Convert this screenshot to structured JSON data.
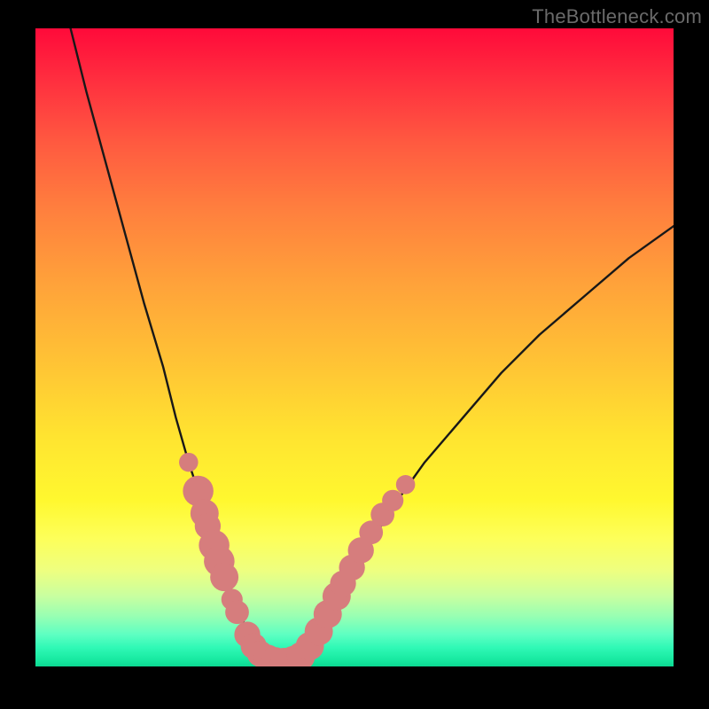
{
  "watermark": "TheBottleneck.com",
  "colors": {
    "curve_stroke": "#181818",
    "dot_fill": "#d67d7d",
    "gradient_top": "#ff0a3a",
    "gradient_bottom": "#0cd892",
    "frame_bg": "#000000"
  },
  "chart_data": {
    "type": "line",
    "title": "",
    "xlabel": "",
    "ylabel": "",
    "xlim": [
      0,
      100
    ],
    "ylim": [
      0,
      100
    ],
    "grid": false,
    "legend": false,
    "annotations": [
      "TheBottleneck.com"
    ],
    "note": "Axes are unlabeled. Values are estimated from pixel positions on a 0–100 normalized scale. Higher y = higher on screen (lower bottleneck).",
    "series": [
      {
        "name": "left-branch",
        "x": [
          5.5,
          8,
          11,
          14,
          17,
          20,
          22,
          24,
          26,
          28,
          30.5,
          33,
          35.5
        ],
        "y": [
          100,
          90,
          79,
          68,
          57,
          47,
          39,
          32,
          26,
          19,
          12,
          6,
          1
        ]
      },
      {
        "name": "valley-floor",
        "x": [
          35.5,
          37,
          38.5,
          40,
          41.5
        ],
        "y": [
          1,
          0.5,
          0.4,
          0.5,
          1
        ]
      },
      {
        "name": "right-branch",
        "x": [
          41.5,
          44,
          47,
          51,
          56,
          61,
          67,
          73,
          79,
          86,
          93,
          100
        ],
        "y": [
          1,
          5,
          10,
          17,
          25,
          32,
          39,
          46,
          52,
          58,
          64,
          69
        ]
      }
    ],
    "markers": {
      "name": "highlight-dots",
      "color": "#d67d7d",
      "points": [
        {
          "x": 24.0,
          "y": 32.0,
          "r": 1.2
        },
        {
          "x": 25.5,
          "y": 27.5,
          "r": 2.2
        },
        {
          "x": 26.5,
          "y": 24.0,
          "r": 2.0
        },
        {
          "x": 27.0,
          "y": 22.0,
          "r": 1.8
        },
        {
          "x": 28.0,
          "y": 19.0,
          "r": 2.2
        },
        {
          "x": 28.8,
          "y": 16.5,
          "r": 2.2
        },
        {
          "x": 29.6,
          "y": 14.0,
          "r": 2.0
        },
        {
          "x": 30.8,
          "y": 10.5,
          "r": 1.4
        },
        {
          "x": 31.6,
          "y": 8.5,
          "r": 1.6
        },
        {
          "x": 33.2,
          "y": 5.0,
          "r": 1.8
        },
        {
          "x": 34.2,
          "y": 3.2,
          "r": 1.8
        },
        {
          "x": 35.2,
          "y": 2.0,
          "r": 1.8
        },
        {
          "x": 36.4,
          "y": 1.2,
          "r": 2.0
        },
        {
          "x": 37.6,
          "y": 0.8,
          "r": 2.0
        },
        {
          "x": 39.0,
          "y": 0.7,
          "r": 2.0
        },
        {
          "x": 40.4,
          "y": 1.0,
          "r": 2.0
        },
        {
          "x": 41.6,
          "y": 1.6,
          "r": 2.0
        },
        {
          "x": 43.0,
          "y": 3.2,
          "r": 2.0
        },
        {
          "x": 44.4,
          "y": 5.5,
          "r": 2.0
        },
        {
          "x": 45.8,
          "y": 8.2,
          "r": 2.0
        },
        {
          "x": 47.2,
          "y": 11.0,
          "r": 2.0
        },
        {
          "x": 48.2,
          "y": 13.0,
          "r": 1.8
        },
        {
          "x": 49.6,
          "y": 15.5,
          "r": 1.8
        },
        {
          "x": 51.0,
          "y": 18.2,
          "r": 1.8
        },
        {
          "x": 52.6,
          "y": 21.0,
          "r": 1.6
        },
        {
          "x": 54.4,
          "y": 23.8,
          "r": 1.6
        },
        {
          "x": 56.0,
          "y": 26.0,
          "r": 1.4
        },
        {
          "x": 58.0,
          "y": 28.5,
          "r": 1.2
        }
      ]
    }
  }
}
